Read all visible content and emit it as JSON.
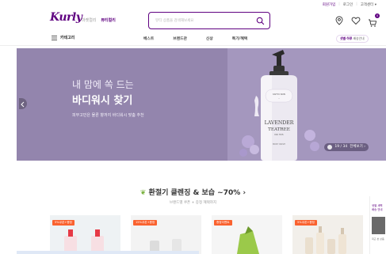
{
  "util": {
    "join": "회원가입",
    "login": "로그인",
    "support": "고객센터 ▾",
    "separator": "|"
  },
  "logo": {
    "text": "Kurly"
  },
  "mall_tabs": [
    {
      "label": "마켓컬리",
      "active": false
    },
    {
      "label": "뷰티컬리",
      "active": true
    }
  ],
  "search": {
    "placeholder": "뷰티 상품을 검색해보세요"
  },
  "header_icons": [
    "location-icon",
    "heart-icon",
    "cart-icon"
  ],
  "cart": {
    "count": "0"
  },
  "gnb": {
    "category": "카테고리",
    "menu": [
      "베스트",
      "브랜드관",
      "신상",
      "특가/혜택"
    ],
    "delivery_prefix": "샛별·하루",
    "delivery_suffix": " 배송안내"
  },
  "banner": {
    "line1": "내 맘에 쏙 드는",
    "line2": "바디워시 찾기",
    "sub": "피부고민은 물론 향까지 바디워시 맞춤 추천",
    "product_label_1": "LAVENDER",
    "product_label_2": "TEATREE",
    "product_label_3": "NO 555",
    "product_brand": "KAHYU SKIN",
    "product_type": "BODY WASH",
    "counter": "19 / 34",
    "view_all": "전체보기 ›",
    "colors": {
      "bg": "#9385ad",
      "accent": "#5f0080"
    }
  },
  "section": {
    "title": "환절기 클렌징 & 보습 ~70%",
    "arrow": "›",
    "subtitle": "브랜드별 쿠폰 + 증정 혜택까지"
  },
  "products": [
    {
      "badge": "5%쿠폰+증정"
    },
    {
      "badge": "15%쿠폰+증정"
    },
    {
      "badge": "증정이벤트"
    },
    {
      "badge": "5%쿠폰+증정"
    }
  ],
  "side_ad": {
    "text1": "샛별 새벽",
    "text2": "배송 안내",
    "caption1": "최근 본 상품",
    "caption2": ""
  }
}
